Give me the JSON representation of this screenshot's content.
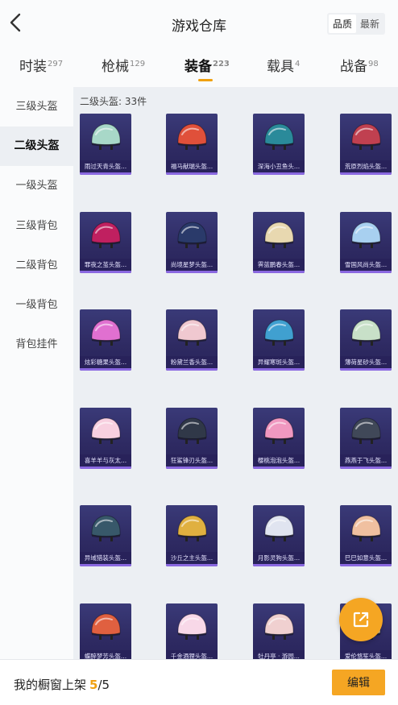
{
  "header": {
    "title": "游戏仓库",
    "back_icon": "chevron-left-icon",
    "sort_options": [
      "品质",
      "最新"
    ],
    "sort_active": "品质"
  },
  "tabs": [
    {
      "label": "时装",
      "count": "297"
    },
    {
      "label": "枪械",
      "count": "129"
    },
    {
      "label": "装备",
      "count": "223",
      "active": true
    },
    {
      "label": "载具",
      "count": "4"
    },
    {
      "label": "战备",
      "count": "98"
    }
  ],
  "sidebar": {
    "items": [
      "三级头盔",
      "二级头盔",
      "一级头盔",
      "三级背包",
      "二级背包",
      "一级背包",
      "背包挂件"
    ],
    "active": "二级头盔"
  },
  "content": {
    "label": "二级头盔: 33件",
    "items": [
      {
        "name": "雨过天青头盔...",
        "color": "#a8d8c8"
      },
      {
        "name": "福马献瑞头盔...",
        "color": "#e0503a"
      },
      {
        "name": "深海小丑鱼头...",
        "color": "#2a8a9a"
      },
      {
        "name": "荒原烈焰头盔...",
        "color": "#c04050"
      },
      {
        "name": "罪夜之茧头盔...",
        "color": "#c02060"
      },
      {
        "name": "尚境星梦头盔...",
        "color": "#2a3a6a"
      },
      {
        "name": "霁蓝鹏春头盔...",
        "color": "#e8d8b0"
      },
      {
        "name": "雪国风尚头盔...",
        "color": "#a8d0f0"
      },
      {
        "name": "炫彩糖果头盔...",
        "color": "#e070d0"
      },
      {
        "name": "粉黛兰香头盔...",
        "color": "#f0c8d0"
      },
      {
        "name": "异耀寒斑头盔...",
        "color": "#40a0d0"
      },
      {
        "name": "薄荷星砂头盔...",
        "color": "#c8e0c8"
      },
      {
        "name": "喜羊羊与灰太...",
        "color": "#f8d0e0"
      },
      {
        "name": "狂鲨锋刃头盔...",
        "color": "#303848"
      },
      {
        "name": "樱桃泡泡头盔...",
        "color": "#f098c0"
      },
      {
        "name": "燕燕于飞头盔...",
        "color": "#404858"
      },
      {
        "name": "异域猎装头盔...",
        "color": "#38586a"
      },
      {
        "name": "沙丘之主头盔...",
        "color": "#e0b040"
      },
      {
        "name": "月影灵狗头盔...",
        "color": "#e0e4f0"
      },
      {
        "name": "巳巳如意头盔...",
        "color": "#f0c0a0"
      },
      {
        "name": "蝶醉梦芳头盔...",
        "color": "#e06040"
      },
      {
        "name": "千金酒狸头盔...",
        "color": "#f8d8e8"
      },
      {
        "name": "牡丹亭 · 游园...",
        "color": "#f0d0d0"
      },
      {
        "name": "爱伦悠笙头盔...",
        "color": "#d8c8a0"
      }
    ]
  },
  "float_button": {
    "icon": "share-external-icon"
  },
  "bottom": {
    "showcase_label": "我的橱窗上架",
    "showcase_count": "5",
    "showcase_total": "/5",
    "edit_label": "编辑"
  },
  "colors": {
    "accent": "#f5a623",
    "card": "#2e2a62"
  }
}
